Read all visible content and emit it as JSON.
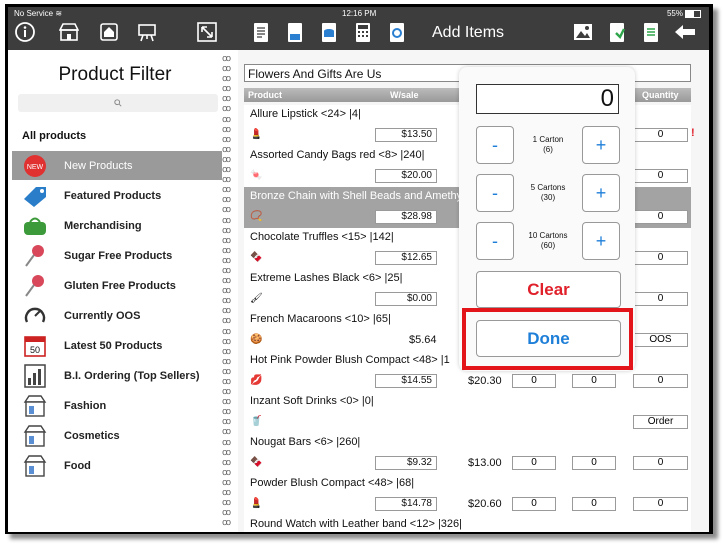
{
  "status": {
    "carrier": "No Service",
    "time": "12:16 PM",
    "battery": "55%"
  },
  "toolbar": {
    "title": "Add Items"
  },
  "left_panel": {
    "title": "Product Filter",
    "all_products": "All products",
    "categories": [
      {
        "label": "New Products",
        "icon": "new-badge"
      },
      {
        "label": "Featured Products",
        "icon": "tag"
      },
      {
        "label": "Merchandising",
        "icon": "bag"
      },
      {
        "label": "Sugar Free Products",
        "icon": "pin"
      },
      {
        "label": "Gluten Free Products",
        "icon": "pin"
      },
      {
        "label": "Currently OOS",
        "icon": "oos"
      },
      {
        "label": "Latest 50 Products",
        "icon": "calendar-50"
      },
      {
        "label": "B.I. Ordering (Top Sellers)",
        "icon": "bar-chart"
      },
      {
        "label": "Fashion",
        "icon": "store"
      },
      {
        "label": "Cosmetics",
        "icon": "store"
      },
      {
        "label": "Food",
        "icon": "store"
      }
    ]
  },
  "customer": "Flowers And Gifts Are Us",
  "table": {
    "headers": {
      "product": "Product",
      "wsale": "W/sale",
      "quantity": "Quantity"
    },
    "rows": [
      {
        "name": "Allure Lipstick <24> |4|",
        "wsale": "$13.50",
        "rrp": "",
        "q1": "",
        "q2": "",
        "qty": "0",
        "flag": "!"
      },
      {
        "name": "Assorted Candy Bags red <8> |240|",
        "wsale": "$20.00",
        "rrp": "",
        "q1": "",
        "q2": "",
        "qty": "0",
        "flag": ""
      },
      {
        "name": "Bronze Chain with Shell Beads and Amethyst",
        "wsale": "$28.98",
        "rrp": "",
        "q1": "",
        "q2": "",
        "qty": "0",
        "flag": ""
      },
      {
        "name": "Chocolate Truffles <15> |142|",
        "wsale": "$12.65",
        "rrp": "",
        "q1": "",
        "q2": "",
        "qty": "0",
        "flag": ""
      },
      {
        "name": "Extreme Lashes Black <6> |25|",
        "wsale": "$0.00",
        "rrp": "",
        "q1": "",
        "q2": "",
        "qty": "0",
        "flag": ""
      },
      {
        "name": "French Macaroons <10> |65|",
        "wsale": "$5.64",
        "rrp": "",
        "q1": "",
        "q2": "",
        "qty": "OOS",
        "flag": ""
      },
      {
        "name": "Hot Pink Powder Blush Compact <48> |1",
        "wsale": "$14.55",
        "rrp": "$20.30",
        "q1": "0",
        "q2": "0",
        "qty": "0",
        "flag": ""
      },
      {
        "name": "Inzant Soft Drinks <0> |0|",
        "wsale": "",
        "rrp": "",
        "q1": "",
        "q2": "",
        "qty": "Order",
        "flag": ""
      },
      {
        "name": "Nougat Bars <6> |260|",
        "wsale": "$9.32",
        "rrp": "$13.00",
        "q1": "0",
        "q2": "0",
        "qty": "0",
        "flag": ""
      },
      {
        "name": "Powder Blush Compact <48> |68|",
        "wsale": "$14.78",
        "rrp": "$20.60",
        "q1": "0",
        "q2": "0",
        "qty": "0",
        "flag": ""
      },
      {
        "name": "Round Watch with Leather band <12> |326|",
        "wsale": "",
        "rrp": "",
        "q1": "",
        "q2": "",
        "qty": "",
        "flag": ""
      }
    ]
  },
  "popover": {
    "quantity": "0",
    "steps": [
      {
        "label1": "1 Carton",
        "label2": "(6)"
      },
      {
        "label1": "5 Cartons",
        "label2": "(30)"
      },
      {
        "label1": "10 Cartons",
        "label2": "(60)"
      }
    ],
    "minus": "-",
    "plus": "+",
    "clear": "Clear",
    "done": "Done"
  },
  "colors": {
    "toolbar": "#3d3d3d",
    "accent_blue": "#1e7fd8",
    "clear_red": "#e0202a",
    "highlight_red": "#e3151a",
    "selected_row": "#a3a3a3"
  }
}
